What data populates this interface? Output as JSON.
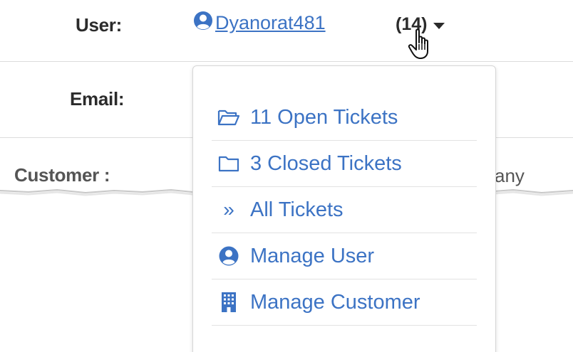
{
  "fields": {
    "user_label": "User:",
    "email_label": "Email:",
    "customer_label": "Customer :",
    "customer_value_tail": "any"
  },
  "user": {
    "username": "Dyanorat481",
    "ticket_count": "(14)"
  },
  "menu": {
    "items": [
      {
        "label": "11 Open Tickets",
        "icon": "folder-open-icon"
      },
      {
        "label": "3 Closed Tickets",
        "icon": "folder-icon"
      },
      {
        "label": "All Tickets",
        "icon": "double-chevron-right-icon"
      },
      {
        "label": "Manage User",
        "icon": "user-circle-icon"
      },
      {
        "label": "Manage Customer",
        "icon": "building-icon"
      }
    ]
  },
  "colors": {
    "link": "#3c73c4",
    "label": "#2b2b2b",
    "divider": "#dcdcdc"
  }
}
